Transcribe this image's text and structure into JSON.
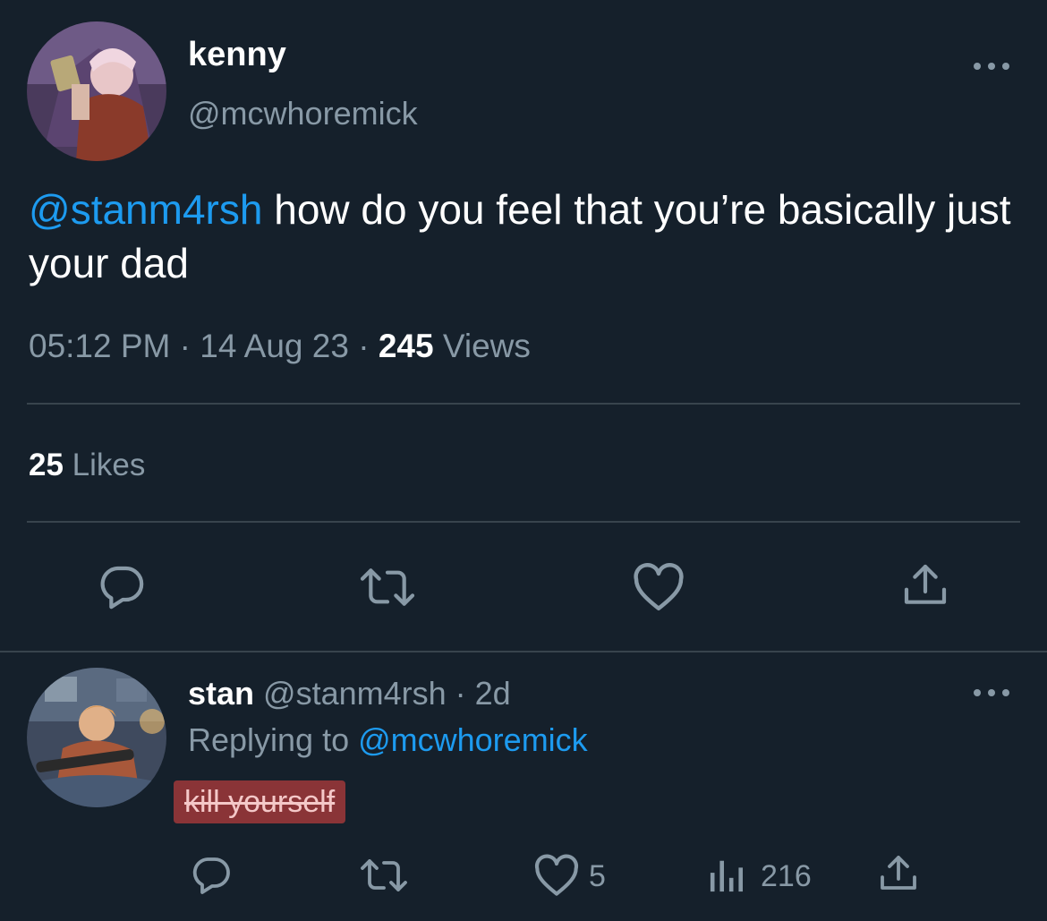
{
  "tweet": {
    "author_name": "kenny",
    "author_handle": "@mcwhoremick",
    "mention": "@stanm4rsh",
    "text": " how do you feel that you’re basically just your dad",
    "time": "05:12 PM",
    "sep1": " · ",
    "date": "14 Aug 23",
    "sep2": " · ",
    "views_count": "245",
    "views_label": " Views",
    "likes_count": "25",
    "likes_label": " Likes"
  },
  "reply": {
    "author_name": "stan",
    "author_handle": " @stanm4rsh",
    "sep": " · ",
    "age": "2d",
    "replying_label": "Replying to ",
    "replying_handle": "@mcwhoremick",
    "text": "kill yourself",
    "like_count": "5",
    "views_count": "216"
  },
  "icons": {
    "more": "more-horizontal-icon",
    "reply": "speech-bubble-icon",
    "retweet": "retweet-icon",
    "like": "heart-icon",
    "share": "share-upload-icon",
    "views": "bar-chart-icon"
  },
  "colors": {
    "background": "#15202b",
    "text": "#ffffff",
    "secondary": "#8899a6",
    "link": "#1d9bf0",
    "divider": "#38444d",
    "highlight": "#8a3437"
  }
}
